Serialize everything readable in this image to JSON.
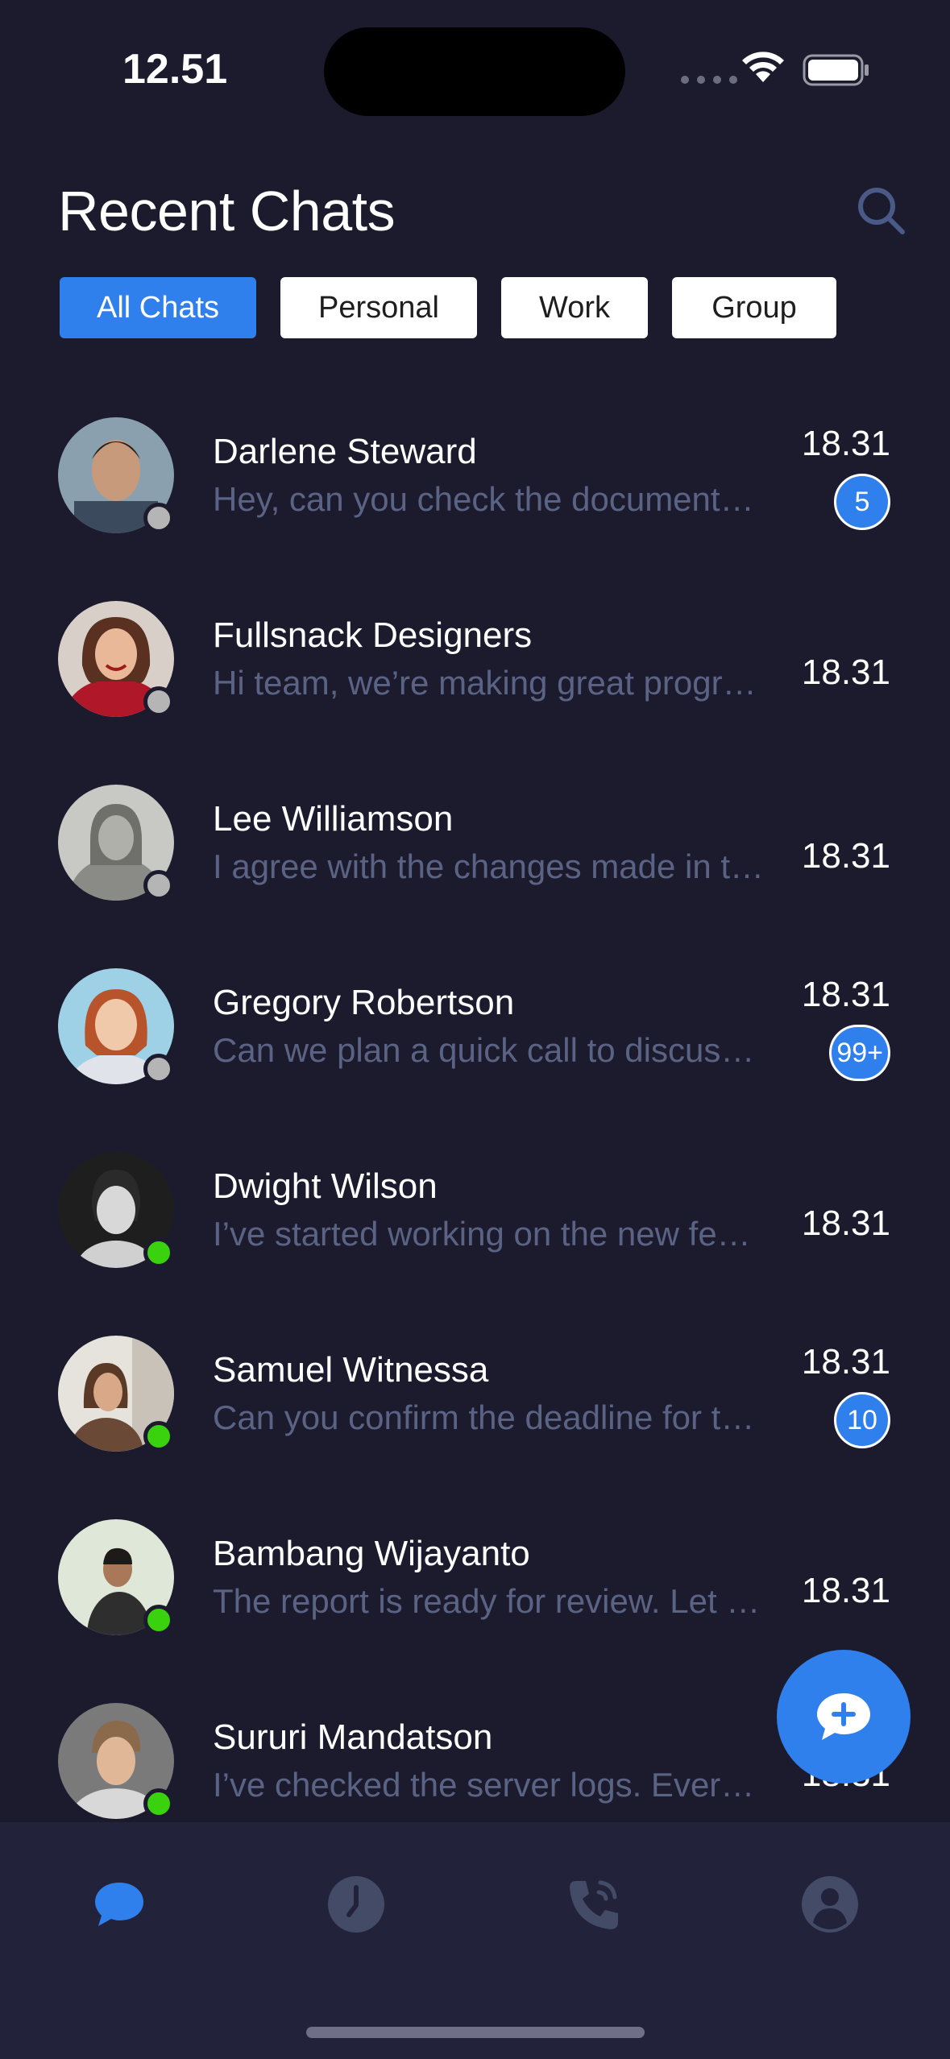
{
  "status_bar": {
    "time": "12.51"
  },
  "header": {
    "title": "Recent Chats"
  },
  "tabs": [
    {
      "label": "All Chats",
      "active": true
    },
    {
      "label": "Personal",
      "active": false
    },
    {
      "label": "Work",
      "active": false
    },
    {
      "label": "Group",
      "active": false
    }
  ],
  "chats": [
    {
      "name": "Darlene Steward",
      "preview": "Hey, can you check the document…",
      "time": "18.31",
      "badge": "5",
      "online": false
    },
    {
      "name": "Fullsnack Designers",
      "preview": "Hi team, we’re making great progr…",
      "time": "18.31",
      "badge": "",
      "online": false
    },
    {
      "name": "Lee Williamson",
      "preview": "I agree with the changes made in t…",
      "time": "18.31",
      "badge": "",
      "online": false
    },
    {
      "name": "Gregory Robertson",
      "preview": "Can we plan a quick call to discus…",
      "time": "18.31",
      "badge": "99+",
      "online": false
    },
    {
      "name": "Dwight Wilson",
      "preview": "I’ve started working on the new fe…",
      "time": "18.31",
      "badge": "",
      "online": true
    },
    {
      "name": "Samuel Witnessa",
      "preview": "Can you confirm the deadline for t…",
      "time": "18.31",
      "badge": "10",
      "online": true
    },
    {
      "name": "Bambang Wijayanto",
      "preview": "The report is ready for review. Let …",
      "time": "18.31",
      "badge": "",
      "online": true
    },
    {
      "name": "Sururi Mandatson",
      "preview": "I’ve checked the server logs. Ever…",
      "time": "18.31",
      "badge": "",
      "online": true
    }
  ],
  "colors": {
    "background": "#1c1b2e",
    "accent": "#2f80ed",
    "online": "#3ad10f",
    "offline": "#b5b5b5",
    "preview_text": "#5b6384",
    "nav_background": "#22223a"
  },
  "icons": {
    "search": "search-icon",
    "fab": "new-chat-icon",
    "nav": [
      "chat-bubble-icon",
      "clock-icon",
      "phone-icon",
      "profile-icon"
    ]
  }
}
